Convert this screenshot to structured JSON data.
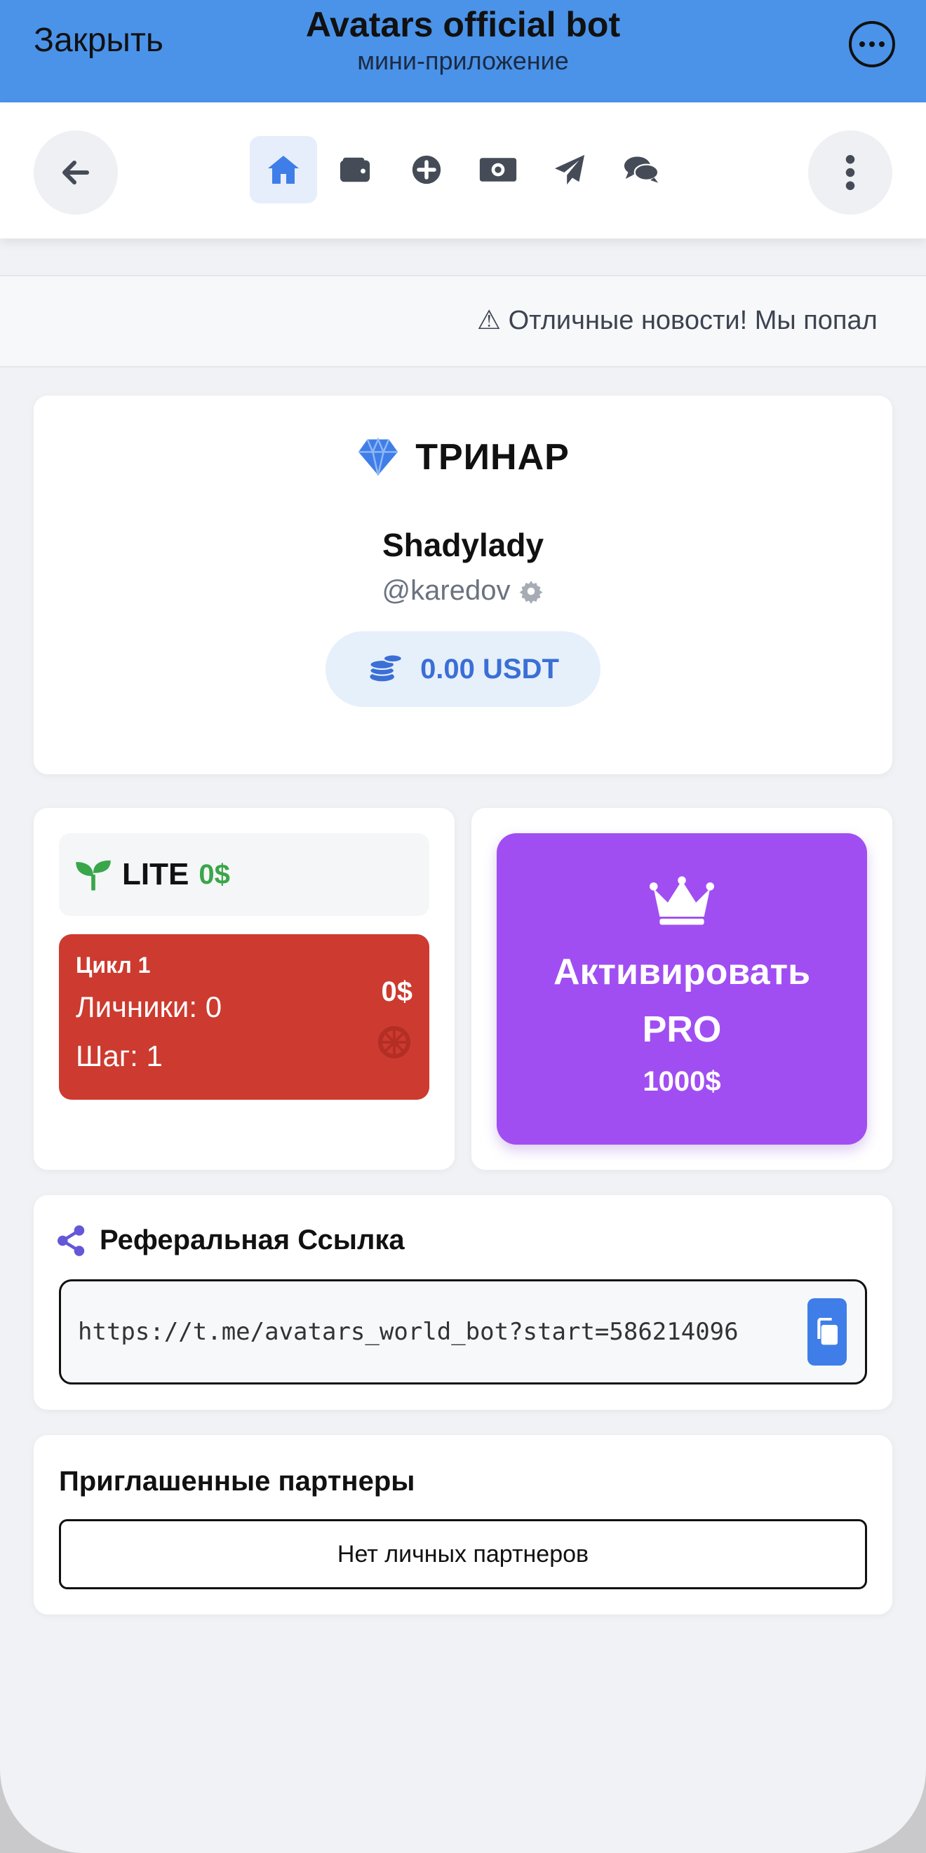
{
  "telegram": {
    "close_label": "Закрыть",
    "title": "Avatars official bot",
    "subtitle": "мини-приложение"
  },
  "nav": {
    "icons": [
      "home-icon",
      "wallet-icon",
      "plus-circle-icon",
      "money-bill-icon",
      "paper-plane-icon",
      "comments-icon"
    ],
    "active_index": 0
  },
  "ticker": {
    "text": "⚠ Отличные новости! Мы попал"
  },
  "profile": {
    "brand": "ТРИНАР",
    "name": "Shadylady",
    "handle": "@karedov",
    "balance": "0.00 USDT"
  },
  "plan": {
    "label": "LITE",
    "price": "0$",
    "cycle_title": "Цикл 1",
    "personal": "Личники: 0",
    "step": "Шаг: 1",
    "amount": "0$"
  },
  "pro": {
    "line1": "Активировать",
    "line2": "PRO",
    "price": "1000$"
  },
  "referral": {
    "title": "Реферальная Ссылка",
    "link": "https://t.me/avatars_world_bot?start=586214096"
  },
  "partners": {
    "title": "Приглашенные партнеры",
    "empty": "Нет личных партнеров"
  },
  "colors": {
    "telegram_header": "#4a93e9",
    "accent_blue": "#3f7ee8",
    "cycle_red": "#cd3a2f",
    "pro_purple": "#a04ef2",
    "lite_green": "#3aa64a"
  }
}
